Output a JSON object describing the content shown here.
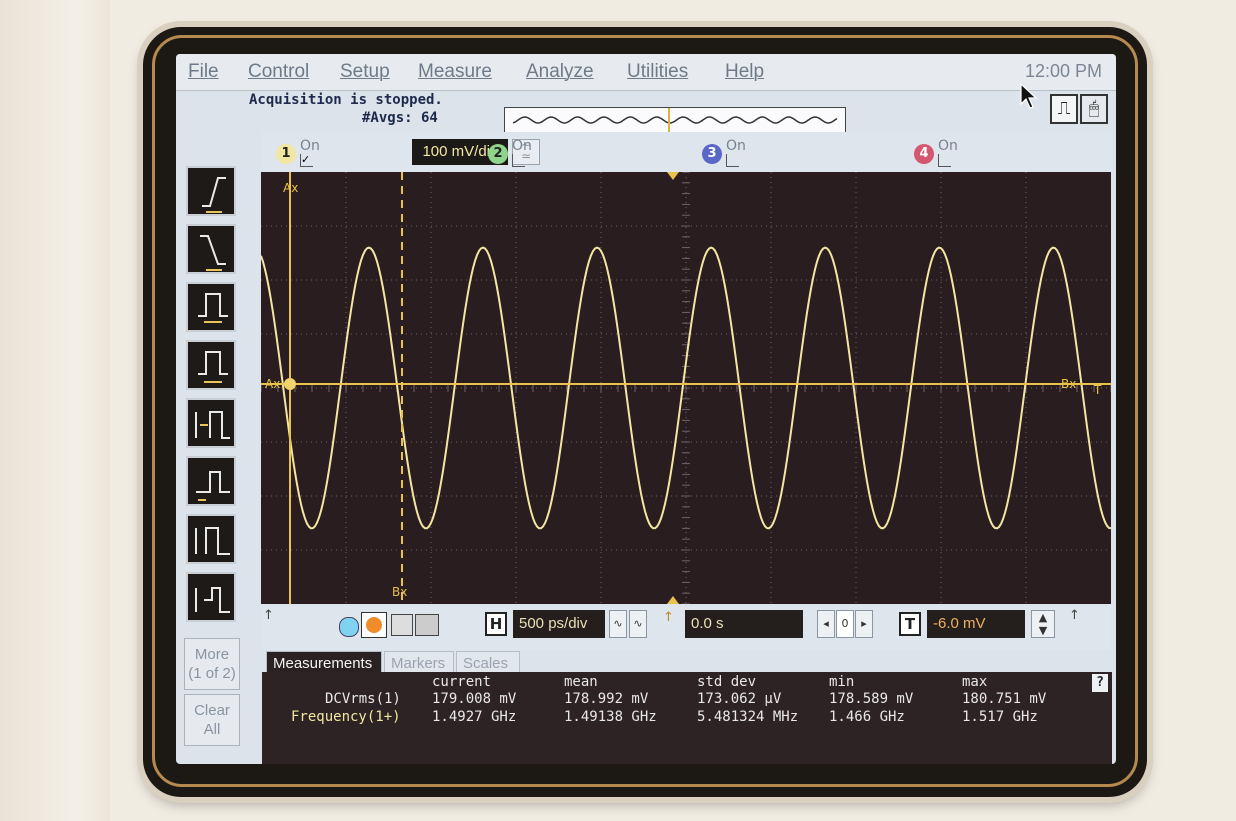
{
  "menu": {
    "items": [
      "File",
      "Control",
      "Setup",
      "Measure",
      "Analyze",
      "Utilities",
      "Help"
    ],
    "clock": "12:00 PM"
  },
  "status": {
    "line1": "Acquisition is stopped.",
    "line2": "#Avgs: 64"
  },
  "channels": [
    {
      "number": "1",
      "on_label": "On",
      "checked": true,
      "color": "#f2e7a0",
      "scale": "100 mV/div"
    },
    {
      "number": "2",
      "on_label": "On",
      "checked": false,
      "color": "#8fd48b"
    },
    {
      "number": "3",
      "on_label": "On",
      "checked": false,
      "color": "#8a9be0"
    },
    {
      "number": "4",
      "on_label": "On",
      "checked": false,
      "color": "#e07d8f"
    }
  ],
  "toolbar_icons": [
    "rising-edge-icon",
    "falling-edge-icon",
    "pulse-width-icon",
    "pulse-count-icon",
    "setup-hold-icon",
    "glitch-icon",
    "runt-icon",
    "timeout-icon"
  ],
  "side_buttons": {
    "more_line1": "More",
    "more_line2": "(1 of 2)",
    "clear_line1": "Clear",
    "clear_line2": "All"
  },
  "markers": {
    "ax_label": "Ax",
    "ax_axis_label": "Ax",
    "bx_label": "Bx",
    "bx_axis_label": "Bx",
    "trigger_label": "T"
  },
  "horizontal": {
    "scale": "500 ps/div",
    "position": "0.0 s",
    "ref_value": "0"
  },
  "trigger": {
    "level": "-6.0 mV"
  },
  "tabs": [
    "Measurements",
    "Markers",
    "Scales"
  ],
  "measurements": {
    "headers": [
      "current",
      "mean",
      "std dev",
      "min",
      "max"
    ],
    "rows": [
      {
        "name": "DCVrms(1)",
        "values": [
          "179.008 mV",
          "178.992 mV",
          "173.062 µV",
          "178.589 mV",
          "180.751 mV"
        ]
      },
      {
        "name": "Frequency(1+)",
        "values": [
          "1.4927 GHz",
          "1.49138 GHz",
          "5.481324 MHz",
          "1.466 GHz",
          "1.517 GHz"
        ]
      }
    ],
    "help": "?"
  },
  "waveform": {
    "color": "#f3e6a2",
    "cycles_on_screen": 7.45,
    "amplitude_div": 2.6
  },
  "colors": {
    "graticule_bg": "#2a1d1f",
    "grid": "#6e6468",
    "trace": "#f3e6a2",
    "marker": "#e8c24a"
  }
}
